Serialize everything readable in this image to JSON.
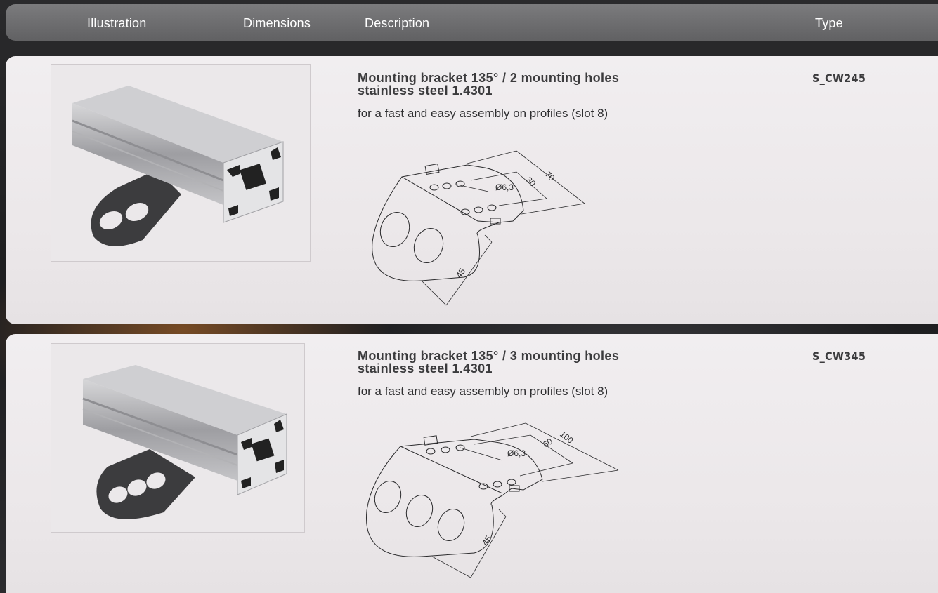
{
  "header": {
    "illustration": "Illustration",
    "dimensions": "Dimensions",
    "description": "Description",
    "type": "Type"
  },
  "products": [
    {
      "title_line1": "Mounting bracket 135° / 2 mounting holes",
      "title_line2": "stainless steel 1.4301",
      "description": "for a fast and easy assembly on profiles (slot 8)",
      "type": "S_CW245",
      "dims": {
        "length": "70",
        "spacing": "30",
        "hole": "Ø6,3",
        "height": "45"
      }
    },
    {
      "title_line1": "Mounting bracket 135° / 3 mounting holes",
      "title_line2": "stainless steel 1.4301",
      "description": "for a fast and easy assembly on profiles (slot 8)",
      "type": "S_CW345",
      "dims": {
        "length": "100",
        "spacing": "60",
        "hole": "Ø6,3",
        "height": "45"
      }
    }
  ]
}
